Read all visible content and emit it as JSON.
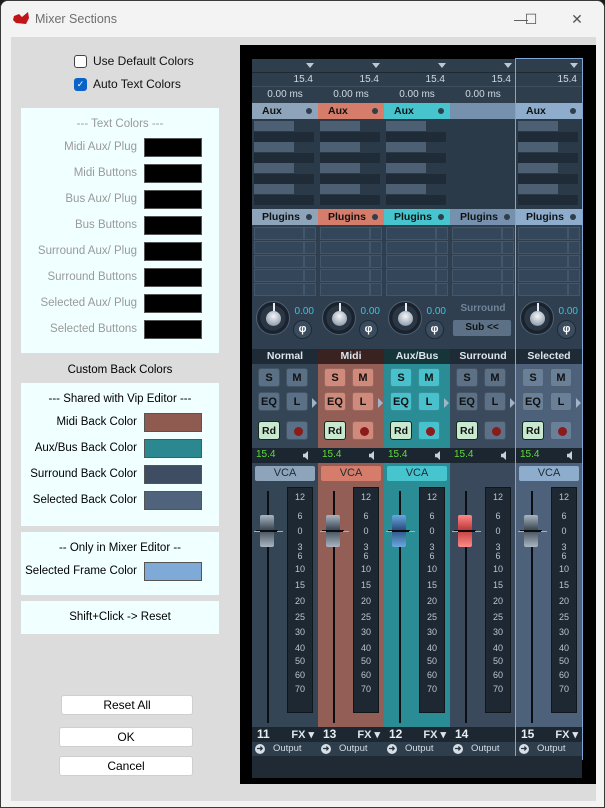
{
  "window": {
    "title": "Mixer Sections",
    "minimize": "—",
    "maximize": "☐",
    "close": "✕",
    "icon": "app-logo-icon"
  },
  "options": {
    "use_default_colors": {
      "label": "Use Default Colors",
      "checked": false
    },
    "auto_text_colors": {
      "label": "Auto Text Colors",
      "checked": true
    }
  },
  "text_colors": {
    "title": "---  Text Colors  ---",
    "rows": [
      {
        "label": "Midi Aux/ Plug",
        "color": "#000000"
      },
      {
        "label": "Midi Buttons",
        "color": "#000000"
      },
      {
        "label": "Bus Aux/ Plug",
        "color": "#000000"
      },
      {
        "label": "Bus Buttons",
        "color": "#000000"
      },
      {
        "label": "Surround Aux/ Plug",
        "color": "#000000"
      },
      {
        "label": "Surround Buttons",
        "color": "#000000"
      },
      {
        "label": "Selected Aux/ Plug",
        "color": "#000000"
      },
      {
        "label": "Selected Buttons",
        "color": "#000000"
      }
    ]
  },
  "back_colors": {
    "heading": "Custom Back Colors",
    "shared_title": "---  Shared with Vip Editor  ---",
    "rows": [
      {
        "label": "Midi Back Color",
        "color": "#8f5a50"
      },
      {
        "label": "Aux/Bus Back Color",
        "color": "#2b8890"
      },
      {
        "label": "Surround Back Color",
        "color": "#3e4d61"
      },
      {
        "label": "Selected Back Color",
        "color": "#4f647c"
      }
    ]
  },
  "mixer_only": {
    "title": "--  Only in Mixer Editor  --",
    "rows": [
      {
        "label": "Selected Frame Color",
        "color": "#7fa9d6"
      }
    ]
  },
  "hint": "Shift+Click -> Reset",
  "buttons": {
    "reset_all": "Reset All",
    "ok": "OK",
    "cancel": "Cancel"
  },
  "mixer": {
    "scale_ticks": [
      "12",
      "6",
      "0",
      "3",
      "6",
      "10",
      "15",
      "20",
      "25",
      "30",
      "40",
      "50",
      "60",
      "70"
    ],
    "strips": [
      {
        "name": "Normal",
        "number": "11",
        "delay_top": "15.4",
        "delay": "0.00 ms",
        "aux": "Aux",
        "plugins": "Plugins",
        "pan": "0.00",
        "phase": "φ",
        "level": "15.4",
        "vca": "VCA",
        "fx": "FX ▾",
        "output": "Output",
        "solo": "S",
        "mute": "M",
        "eq": "EQ",
        "listen": "L",
        "read": "Rd",
        "back": "#344556",
        "btn": "#5a7086",
        "sect": "#8ea4ba",
        "name_bg": "#1e2a36",
        "cap": "gray",
        "selected": false,
        "surround": false
      },
      {
        "name": "Midi",
        "number": "13",
        "delay_top": "15.4",
        "delay": "0.00 ms",
        "aux": "Aux",
        "plugins": "Plugins",
        "pan": "0.00",
        "phase": "φ",
        "level": "15.4",
        "vca": "VCA",
        "fx": "FX ▾",
        "output": "Output",
        "solo": "S",
        "mute": "M",
        "eq": "EQ",
        "listen": "L",
        "read": "Rd",
        "back": "#935e55",
        "btn": "#d08a7c",
        "sect": "#d57c6a",
        "name_bg": "#3a2220",
        "cap": "gray",
        "selected": false,
        "surround": false
      },
      {
        "name": "Aux/Bus",
        "number": "12",
        "delay_top": "15.4",
        "delay": "0.00 ms",
        "aux": "Aux",
        "plugins": "Plugins",
        "pan": "0.00",
        "phase": "φ",
        "level": "15.4",
        "vca": "VCA",
        "fx": "FX ▾",
        "output": "Output",
        "solo": "S",
        "mute": "M",
        "eq": "EQ",
        "listen": "L",
        "read": "Rd",
        "back": "#2a8d96",
        "btn": "#49c1cc",
        "sect": "#47c5cf",
        "name_bg": "#153538",
        "cap": "blue",
        "selected": false,
        "surround": false
      },
      {
        "name": "Surround",
        "number": "14",
        "delay_top": "15.4",
        "delay": "0.00 ms",
        "aux": "",
        "plugins": "Plugins",
        "surround_label": "Surround",
        "sub": "Sub  <<",
        "level": "15.4",
        "output": "Output",
        "solo": "S",
        "mute": "M",
        "eq": "EQ",
        "listen": "L",
        "read": "Rd",
        "back": "#3a4a5c",
        "btn": "#5d7186",
        "sect": "#7691ad",
        "name_bg": "#1e2a36",
        "cap": "red",
        "selected": false,
        "surround": true
      },
      {
        "name": "Selected",
        "number": "15",
        "delay_top": "15.4",
        "delay": "",
        "aux": "Aux",
        "plugins": "Plugins",
        "pan": "0.00",
        "phase": "φ",
        "level": "15.4",
        "vca": "VCA",
        "fx": "FX ▾",
        "output": "Output",
        "solo": "S",
        "mute": "M",
        "eq": "EQ",
        "listen": "L",
        "read": "Rd",
        "back": "#4d627a",
        "btn": "#6a8098",
        "sect": "#8eaccc",
        "name_bg": "#1e2a36",
        "cap": "gray",
        "selected": true,
        "surround": false
      }
    ]
  }
}
